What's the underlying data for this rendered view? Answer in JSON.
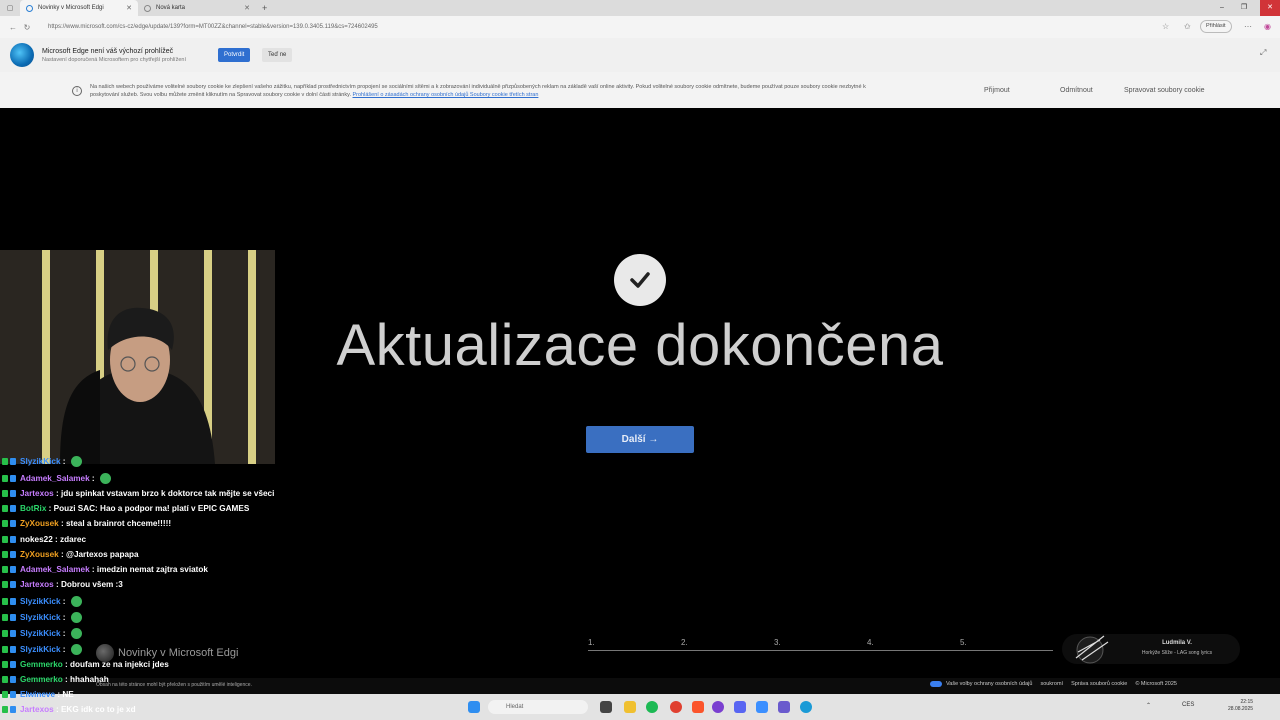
{
  "browser": {
    "tabs": [
      {
        "label": "Novinky v Microsoft Edgi"
      },
      {
        "label": "Nová karta"
      }
    ],
    "url": "https://www.microsoft.com/cs-cz/edge/update/139?form=MT00ZZ&channel=stable&version=139.0.3405.119&cs=724602495",
    "signin_label": "Přihlásit"
  },
  "infobar": {
    "title": "Microsoft Edge není váš výchozí prohlížeč",
    "subtitle": "Nastavení doporučená Microsoftem pro chytřejší prohlížení",
    "confirm_label": "Potvrdit",
    "dismiss_label": "Teď ne"
  },
  "cookie_banner": {
    "text": "Na našich webech používáme volitelné soubory cookie ke zlepšení vašeho zážitku, například prostřednictvím propojení se sociálními sítěmi a k zobrazování individuálně přizpůsobených reklam na základě vaší online aktivity. Pokud volitelné soubory cookie odmítnete, budeme používat pouze soubory cookie nezbytné k poskytování služeb. Svou volbu můžete změnit kliknutím na Spravovat soubory cookie v dolní části stránky.",
    "link_text": "Prohlášení o zásadách ochrany osobních údajů  Soubory cookie třetích stran",
    "accept_label": "Přijmout",
    "reject_label": "Odmítnout",
    "manage_label": "Spravovat soubory cookie"
  },
  "main": {
    "headline": "Aktualizace dokončena",
    "next_label": "Další →",
    "steps": [
      "1.",
      "2.",
      "3.",
      "4.",
      "5."
    ]
  },
  "music": {
    "title": "Ludmila V.",
    "subtitle": "Horkýže Slíže - LAG song lyrics"
  },
  "footer": {
    "note": "Obsah na této stránce mohl být přeložen s použitím umělé inteligence.",
    "privacy_choices": "Vaše volby ochrany osobních údajů",
    "privacy": "soukromí",
    "cookie_mgmt": "Správa souborů cookie",
    "copyright": "© Microsoft 2025"
  },
  "taskbar": {
    "search_placeholder": "Hledat",
    "lang": "CES",
    "time": "22:15",
    "date": "28.08.2025"
  },
  "overlay": {
    "watermark": "Novinky v Microsoft Edgi"
  },
  "chat": [
    {
      "user": "SlyzikKick",
      "msg": " : ",
      "color": "#3b8fff"
    },
    {
      "user": "Adamek_Salamek",
      "msg": " : ",
      "color": "#c77dff"
    },
    {
      "user": "Jartexos",
      "msg": " : jdu spinkat vstavam brzo k doktorce tak mějte se všeci",
      "color": "#c77dff"
    },
    {
      "user": "BotRix",
      "msg": " : Pouzi SAC: Hao a podpor ma! platí v EPIC GAMES",
      "color": "#2bd66a"
    },
    {
      "user": "ZyXousek",
      "msg": " : steal a brainrot chceme!!!!!",
      "color": "#f0a020"
    },
    {
      "user": "nokes22",
      "msg": " : zdarec",
      "color": "#ffffff"
    },
    {
      "user": "ZyXousek",
      "msg": " : @Jartexos papapa",
      "color": "#f0a020"
    },
    {
      "user": "Adamek_Salamek",
      "msg": " : imedzin nemat zajtra sviatok",
      "color": "#c77dff"
    },
    {
      "user": "Jartexos",
      "msg": " : Dobrou všem :3",
      "color": "#c77dff"
    },
    {
      "user": "SlyzikKick",
      "msg": " : ",
      "color": "#3b8fff"
    },
    {
      "user": "SlyzikKick",
      "msg": " : ",
      "color": "#3b8fff"
    },
    {
      "user": "SlyzikKick",
      "msg": " : ",
      "color": "#3b8fff"
    },
    {
      "user": "SlyzikKick",
      "msg": " : ",
      "color": "#3b8fff"
    },
    {
      "user": "Gemmerko",
      "msg": " : doufam ze na injekci jdes",
      "color": "#2bd66a"
    },
    {
      "user": "Gemmerko",
      "msg": " : hhahahah",
      "color": "#2bd66a"
    },
    {
      "user": "Elwineve",
      "msg": " : NE",
      "color": "#3b8fff"
    },
    {
      "user": "Jartexos",
      "msg": " : EKG idk co to je xd",
      "color": "#c77dff"
    }
  ]
}
